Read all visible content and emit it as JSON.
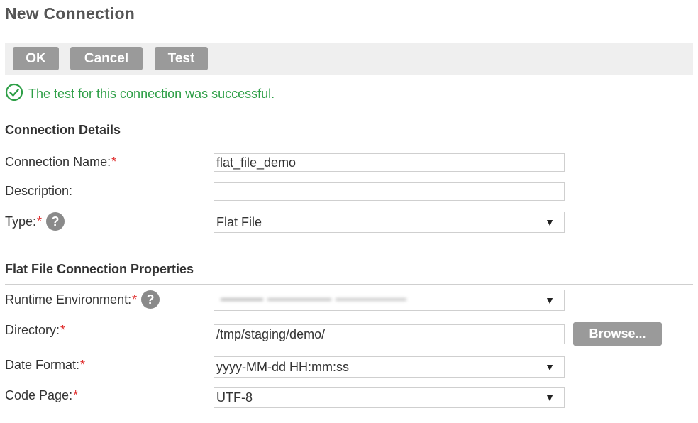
{
  "page": {
    "title": "New Connection"
  },
  "toolbar": {
    "ok_label": "OK",
    "cancel_label": "Cancel",
    "test_label": "Test"
  },
  "status": {
    "message": "The test for this connection was successful.",
    "icon": "check-circle-icon",
    "color": "#2e9f47"
  },
  "connection_details": {
    "heading": "Connection Details",
    "name_label": "Connection Name:",
    "name_value": "flat_file_demo",
    "description_label": "Description:",
    "description_value": "",
    "type_label": "Type:",
    "type_value": "Flat File"
  },
  "flat_file_properties": {
    "heading": "Flat File Connection Properties",
    "runtime_label": "Runtime Environment:",
    "runtime_value": "",
    "directory_label": "Directory:",
    "directory_value": "/tmp/staging/demo/",
    "browse_label": "Browse...",
    "date_format_label": "Date Format:",
    "date_format_value": "yyyy-MM-dd HH:mm:ss",
    "code_page_label": "Code Page:",
    "code_page_value": "UTF-8"
  },
  "common": {
    "required_marker": "*",
    "dropdown_arrow": "▼"
  },
  "colors": {
    "button_bg": "#9a9a9a",
    "toolbar_bg": "#efefef",
    "required": "#e03030",
    "success": "#2e9f47"
  }
}
